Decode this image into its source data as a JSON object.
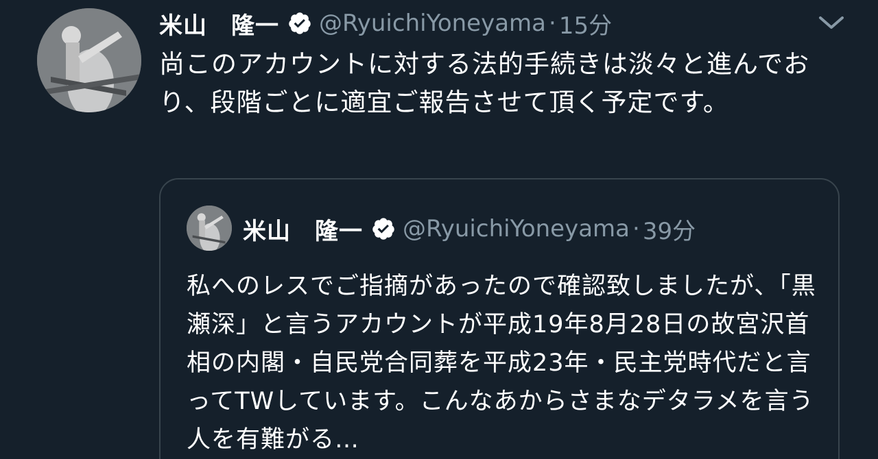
{
  "tweet": {
    "display_name": "米山　隆一",
    "handle": "@RyuichiYoneyama",
    "separator": "·",
    "time": "15分",
    "text": "尚このアカウントに対する法的手続きは淡々と進んでおり、段階ごとに適宜ご報告させて頂く予定です。",
    "avatar_icon": "profile-photo-icon",
    "verified_icon": "verified-badge-icon",
    "menu_icon": "chevron-down-icon"
  },
  "quoted_tweet": {
    "display_name": "米山　隆一",
    "handle": "@RyuichiYoneyama",
    "separator": "·",
    "time": "39分",
    "text": "私へのレスでご指摘があったので確認致しましたが、「黒瀬深」と言うアカウントが平成19年8月28日の故宮沢首相の内閣・自民党合同葬を平成23年・民主党時代だと言ってTWしています。こんなあからさまなデタラメを言う人を有難がる…",
    "avatar_icon": "profile-photo-icon",
    "verified_icon": "verified-badge-icon"
  },
  "colors": {
    "background": "#15202b",
    "border": "#38444d",
    "secondary_text": "#8899a6",
    "primary_text": "#ffffff",
    "verified_badge": "#ffffff"
  }
}
